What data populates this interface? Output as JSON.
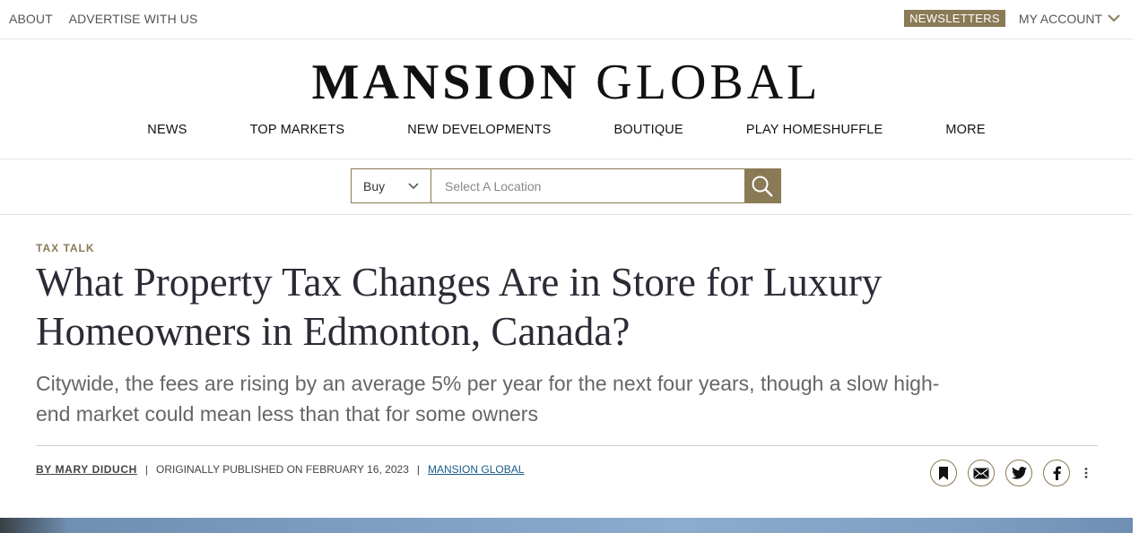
{
  "topbar": {
    "about": "ABOUT",
    "advertise": "ADVERTISE WITH US",
    "newsletters": "NEWSLETTERS",
    "account": "MY ACCOUNT"
  },
  "logo": {
    "part1": "MANSION",
    "part2": "GLOBAL"
  },
  "nav": [
    "NEWS",
    "TOP MARKETS",
    "NEW DEVELOPMENTS",
    "BOUTIQUE",
    "PLAY HOMESHUFFLE",
    "MORE"
  ],
  "search": {
    "mode": "Buy",
    "placeholder": "Select A Location"
  },
  "article": {
    "kicker": "TAX TALK",
    "headline": "What Property Tax Changes Are in Store for Luxury Homeowners in Edmonton, Canada?",
    "dek": "Citywide, the fees are rising by an average 5% per year for the next four years, though a slow high-end market could mean less than that for some owners",
    "author": "BY MARY DIDUCH",
    "published": "ORIGINALLY PUBLISHED ON FEBRUARY 16, 2023",
    "source": "MANSION GLOBAL",
    "sep": "|"
  },
  "colors": {
    "accent": "#8a7a55",
    "link": "#1a5b8a"
  }
}
